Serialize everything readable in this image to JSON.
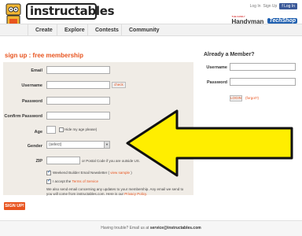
{
  "header": {
    "logo": "instructables",
    "login_link": "Log In",
    "signup_link": "Sign Up",
    "facebook_login": "Log In",
    "partner_handyman": "Handyman",
    "partner_handyman_tag": "THE FAMILY",
    "partner_techshop": "TechShop"
  },
  "nav": {
    "items": [
      "Create",
      "Explore",
      "Contests",
      "Community"
    ]
  },
  "signup": {
    "title": "sign up : free membership",
    "email_label": "Email",
    "username_label": "Username",
    "check_button": "check",
    "password_label": "Password",
    "confirm_label": "Confirm Password",
    "age_label": "Age",
    "hide_age_label": "Hide my age please)",
    "gender_label": "Gender",
    "gender_value": "(select)",
    "zip_label": "ZIP",
    "zip_note": "or Postal Code if you are outside US.",
    "newsletter_label": "Weekend Builder Email Newsletter (",
    "newsletter_link": "view sample",
    "newsletter_end": ")",
    "terms_label": "I accept the",
    "terms_link": "Terms of Service",
    "privacy_line1": "We also send email concerning any updates to your membership. Any email we send to",
    "privacy_line2": "you will come from instructables.com. Here is our",
    "privacy_link": "Privacy Policy.",
    "submit_button": "SIGN UP!"
  },
  "member": {
    "title": "Already a Member?",
    "username_label": "Username",
    "password_label": "Password",
    "login_button": "LOGIN",
    "forgot_link": "(forgot?)"
  },
  "footer": {
    "text_prefix": "Having trouble? Email us at",
    "email": "service@instructables.com"
  },
  "colors": {
    "accent": "#e8541f",
    "form_bg": "#f0ece6",
    "arrow_fill": "#ffee00"
  }
}
